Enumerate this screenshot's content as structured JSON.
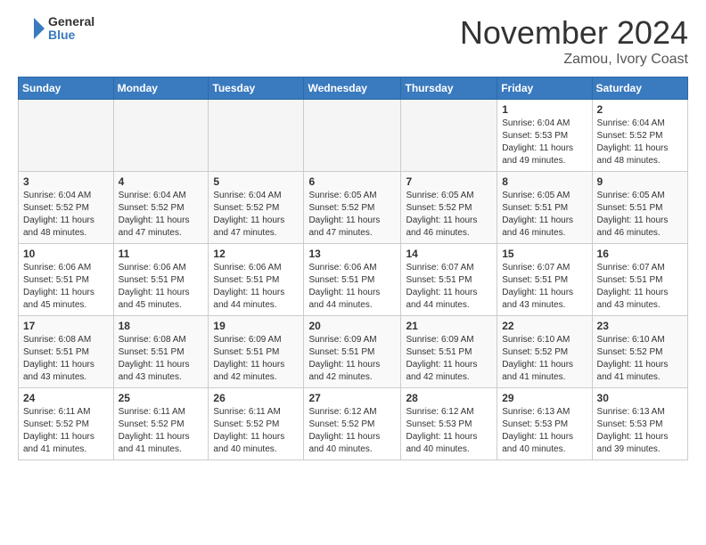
{
  "logo": {
    "general": "General",
    "blue": "Blue"
  },
  "header": {
    "month": "November 2024",
    "location": "Zamou, Ivory Coast"
  },
  "weekdays": [
    "Sunday",
    "Monday",
    "Tuesday",
    "Wednesday",
    "Thursday",
    "Friday",
    "Saturday"
  ],
  "weeks": [
    [
      {
        "day": "",
        "info": ""
      },
      {
        "day": "",
        "info": ""
      },
      {
        "day": "",
        "info": ""
      },
      {
        "day": "",
        "info": ""
      },
      {
        "day": "",
        "info": ""
      },
      {
        "day": "1",
        "info": "Sunrise: 6:04 AM\nSunset: 5:53 PM\nDaylight: 11 hours\nand 49 minutes."
      },
      {
        "day": "2",
        "info": "Sunrise: 6:04 AM\nSunset: 5:52 PM\nDaylight: 11 hours\nand 48 minutes."
      }
    ],
    [
      {
        "day": "3",
        "info": "Sunrise: 6:04 AM\nSunset: 5:52 PM\nDaylight: 11 hours\nand 48 minutes."
      },
      {
        "day": "4",
        "info": "Sunrise: 6:04 AM\nSunset: 5:52 PM\nDaylight: 11 hours\nand 47 minutes."
      },
      {
        "day": "5",
        "info": "Sunrise: 6:04 AM\nSunset: 5:52 PM\nDaylight: 11 hours\nand 47 minutes."
      },
      {
        "day": "6",
        "info": "Sunrise: 6:05 AM\nSunset: 5:52 PM\nDaylight: 11 hours\nand 47 minutes."
      },
      {
        "day": "7",
        "info": "Sunrise: 6:05 AM\nSunset: 5:52 PM\nDaylight: 11 hours\nand 46 minutes."
      },
      {
        "day": "8",
        "info": "Sunrise: 6:05 AM\nSunset: 5:51 PM\nDaylight: 11 hours\nand 46 minutes."
      },
      {
        "day": "9",
        "info": "Sunrise: 6:05 AM\nSunset: 5:51 PM\nDaylight: 11 hours\nand 46 minutes."
      }
    ],
    [
      {
        "day": "10",
        "info": "Sunrise: 6:06 AM\nSunset: 5:51 PM\nDaylight: 11 hours\nand 45 minutes."
      },
      {
        "day": "11",
        "info": "Sunrise: 6:06 AM\nSunset: 5:51 PM\nDaylight: 11 hours\nand 45 minutes."
      },
      {
        "day": "12",
        "info": "Sunrise: 6:06 AM\nSunset: 5:51 PM\nDaylight: 11 hours\nand 44 minutes."
      },
      {
        "day": "13",
        "info": "Sunrise: 6:06 AM\nSunset: 5:51 PM\nDaylight: 11 hours\nand 44 minutes."
      },
      {
        "day": "14",
        "info": "Sunrise: 6:07 AM\nSunset: 5:51 PM\nDaylight: 11 hours\nand 44 minutes."
      },
      {
        "day": "15",
        "info": "Sunrise: 6:07 AM\nSunset: 5:51 PM\nDaylight: 11 hours\nand 43 minutes."
      },
      {
        "day": "16",
        "info": "Sunrise: 6:07 AM\nSunset: 5:51 PM\nDaylight: 11 hours\nand 43 minutes."
      }
    ],
    [
      {
        "day": "17",
        "info": "Sunrise: 6:08 AM\nSunset: 5:51 PM\nDaylight: 11 hours\nand 43 minutes."
      },
      {
        "day": "18",
        "info": "Sunrise: 6:08 AM\nSunset: 5:51 PM\nDaylight: 11 hours\nand 43 minutes."
      },
      {
        "day": "19",
        "info": "Sunrise: 6:09 AM\nSunset: 5:51 PM\nDaylight: 11 hours\nand 42 minutes."
      },
      {
        "day": "20",
        "info": "Sunrise: 6:09 AM\nSunset: 5:51 PM\nDaylight: 11 hours\nand 42 minutes."
      },
      {
        "day": "21",
        "info": "Sunrise: 6:09 AM\nSunset: 5:51 PM\nDaylight: 11 hours\nand 42 minutes."
      },
      {
        "day": "22",
        "info": "Sunrise: 6:10 AM\nSunset: 5:52 PM\nDaylight: 11 hours\nand 41 minutes."
      },
      {
        "day": "23",
        "info": "Sunrise: 6:10 AM\nSunset: 5:52 PM\nDaylight: 11 hours\nand 41 minutes."
      }
    ],
    [
      {
        "day": "24",
        "info": "Sunrise: 6:11 AM\nSunset: 5:52 PM\nDaylight: 11 hours\nand 41 minutes."
      },
      {
        "day": "25",
        "info": "Sunrise: 6:11 AM\nSunset: 5:52 PM\nDaylight: 11 hours\nand 41 minutes."
      },
      {
        "day": "26",
        "info": "Sunrise: 6:11 AM\nSunset: 5:52 PM\nDaylight: 11 hours\nand 40 minutes."
      },
      {
        "day": "27",
        "info": "Sunrise: 6:12 AM\nSunset: 5:52 PM\nDaylight: 11 hours\nand 40 minutes."
      },
      {
        "day": "28",
        "info": "Sunrise: 6:12 AM\nSunset: 5:53 PM\nDaylight: 11 hours\nand 40 minutes."
      },
      {
        "day": "29",
        "info": "Sunrise: 6:13 AM\nSunset: 5:53 PM\nDaylight: 11 hours\nand 40 minutes."
      },
      {
        "day": "30",
        "info": "Sunrise: 6:13 AM\nSunset: 5:53 PM\nDaylight: 11 hours\nand 39 minutes."
      }
    ]
  ]
}
